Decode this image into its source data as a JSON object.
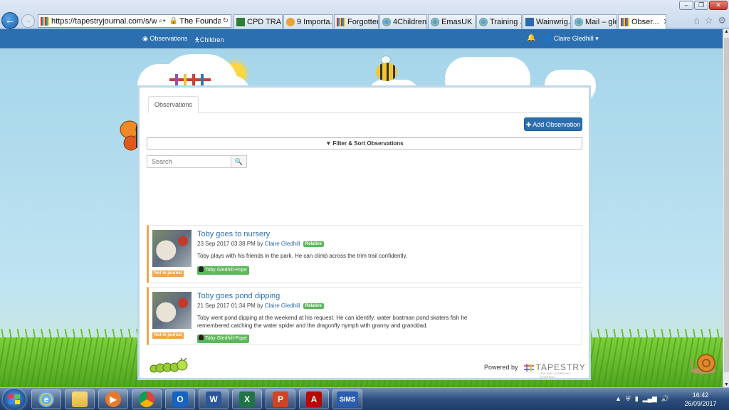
{
  "browser": {
    "url": "https://tapestryjournal.com/s/wair",
    "site_identity": "The Foundati...",
    "tabs": [
      {
        "label": "CPD TRA...",
        "active": false
      },
      {
        "label": "9 Importa...",
        "active": false
      },
      {
        "label": "Forgotten...",
        "active": false
      },
      {
        "label": "4Children...",
        "active": false
      },
      {
        "label": "EmasUK |...",
        "active": false
      },
      {
        "label": "Training ...",
        "active": false
      },
      {
        "label": "Wainwrig...",
        "active": false
      },
      {
        "label": "Mail – gle...",
        "active": false
      },
      {
        "label": "Obser...",
        "active": true
      }
    ]
  },
  "nav": {
    "observations": "Observations",
    "children": "Children",
    "user": "Claire Gledhill"
  },
  "panel": {
    "tab_label": "Observations",
    "add_button": "Add Observation",
    "filter_label": "Filter & Sort Observations",
    "search_placeholder": "Search"
  },
  "observations": [
    {
      "title": "Toby goes to nursery",
      "date": "23 Sep 2017 03:38 PM by",
      "author": "Claire Gledhill",
      "role": "Relative",
      "text": "Toby plays with his friends in the park. He can climb across the trim trail confidently.",
      "status": "Not in journal",
      "child": "Toby Gledhill-Pope"
    },
    {
      "title": "Toby goes pond dipping",
      "date": "21 Sep 2017 01:34 PM by",
      "author": "Claire Gledhill",
      "role": "Relative",
      "text": "Toby went pond dipping at the weekend at his request. He can identify: water boatman pond skaters fish he remembered catching the water spider and the dragonfly nymph with granny and granddad.",
      "status": "Not in journal",
      "child": "Toby Gledhill-Pope"
    }
  ],
  "footer": {
    "powered_by": "Powered by",
    "brand": "TAPESTRY",
    "brand_sub": "ONLINE LEARNING JOURNAL"
  },
  "taskbar": {
    "apps": [
      "internet-explorer",
      "file-explorer",
      "media-player",
      "chrome",
      "outlook",
      "word",
      "excel",
      "powerpoint",
      "acrobat",
      "sims"
    ],
    "sims_label": "SIMS",
    "time": "16:42",
    "date": "26/09/2017"
  }
}
